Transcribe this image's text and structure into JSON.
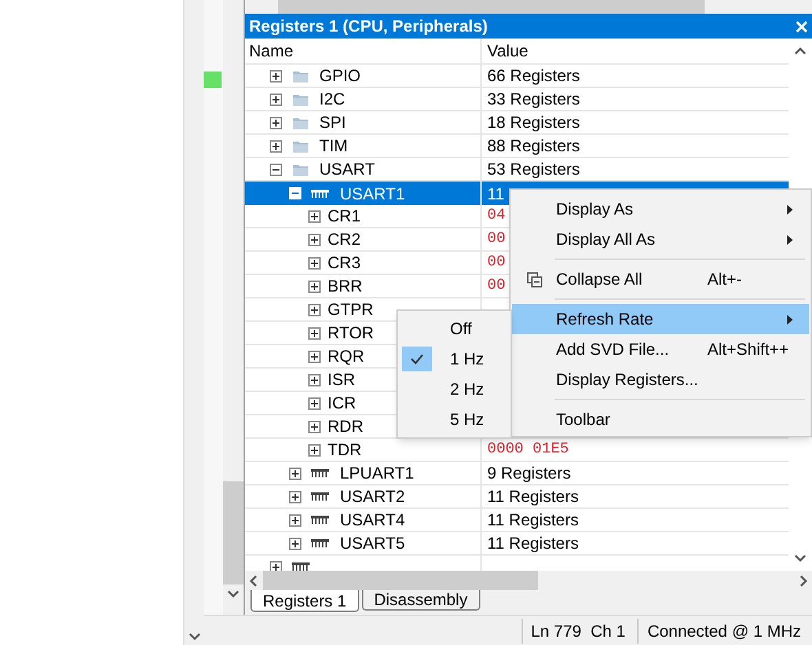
{
  "panel": {
    "title": "Registers 1 (CPU, Peripherals)",
    "columns": [
      "Name",
      "Value"
    ],
    "tree": [
      {
        "name": "GPIO",
        "value": "66 Registers",
        "kind": "group",
        "expanded": false,
        "selected": false
      },
      {
        "name": "I2C",
        "value": "33 Registers",
        "kind": "group",
        "expanded": false,
        "selected": false
      },
      {
        "name": "SPI",
        "value": "18 Registers",
        "kind": "group",
        "expanded": false,
        "selected": false
      },
      {
        "name": "TIM",
        "value": "88 Registers",
        "kind": "group",
        "expanded": false,
        "selected": false
      },
      {
        "name": "USART",
        "value": "53 Registers",
        "kind": "group",
        "expanded": true,
        "selected": false,
        "children": [
          {
            "name": "USART1",
            "value": "11",
            "kind": "peripheral",
            "expanded": true,
            "selected": true,
            "children": [
              {
                "name": "CR1",
                "value": "04",
                "kind": "register",
                "expanded": false,
                "selected": false,
                "changed": true
              },
              {
                "name": "CR2",
                "value": "00",
                "kind": "register",
                "expanded": false,
                "selected": false,
                "changed": true
              },
              {
                "name": "CR3",
                "value": "00",
                "kind": "register",
                "expanded": false,
                "selected": false,
                "changed": true
              },
              {
                "name": "BRR",
                "value": "00",
                "kind": "register",
                "expanded": false,
                "selected": false,
                "changed": true
              },
              {
                "name": "GTPR",
                "kind": "register",
                "expanded": false,
                "selected": false
              },
              {
                "name": "RTOR",
                "kind": "register",
                "expanded": false,
                "selected": false
              },
              {
                "name": "RQR",
                "kind": "register",
                "expanded": false,
                "selected": false
              },
              {
                "name": "ISR",
                "kind": "register",
                "expanded": false,
                "selected": false
              },
              {
                "name": "ICR",
                "kind": "register",
                "expanded": false,
                "selected": false
              },
              {
                "name": "RDR",
                "kind": "register",
                "expanded": false,
                "selected": false
              },
              {
                "name": "TDR",
                "value": "0000 01E5",
                "kind": "register",
                "expanded": false,
                "selected": false,
                "changed": true
              }
            ]
          },
          {
            "name": "LPUART1",
            "value": "9 Registers",
            "kind": "peripheral",
            "expanded": false,
            "selected": false
          },
          {
            "name": "USART2",
            "value": "11 Registers",
            "kind": "peripheral",
            "expanded": false,
            "selected": false
          },
          {
            "name": "USART4",
            "value": "11 Registers",
            "kind": "peripheral",
            "expanded": false,
            "selected": false
          },
          {
            "name": "USART5",
            "value": "11 Registers",
            "kind": "peripheral",
            "expanded": false,
            "selected": false
          }
        ]
      },
      {
        "kind": "peripheral",
        "expanded": false,
        "selected": false
      }
    ]
  },
  "tabs": [
    {
      "label": "Registers 1",
      "selected": true
    },
    {
      "label": "Disassembly",
      "selected": false
    }
  ],
  "status_bar": [
    "Ln 779  Ch 1",
    "Connected @ 1 MHz"
  ],
  "context_menu": [
    {
      "kind": "item",
      "label": "Display As",
      "submenu": true,
      "highlighted": false
    },
    {
      "kind": "item",
      "label": "Display All As",
      "submenu": true,
      "highlighted": false
    },
    {
      "kind": "separator"
    },
    {
      "kind": "icon_item",
      "label": "Collapse All",
      "shortcut": "Alt+-",
      "submenu": false,
      "highlighted": false
    },
    {
      "kind": "separator"
    },
    {
      "kind": "item",
      "label": "Refresh Rate",
      "submenu": true,
      "highlighted": true
    },
    {
      "kind": "item",
      "label": "Add SVD File...",
      "shortcut": "Alt+Shift++",
      "submenu": false,
      "highlighted": false
    },
    {
      "kind": "item",
      "label": "Display Registers...",
      "submenu": false,
      "highlighted": false
    },
    {
      "kind": "separator"
    },
    {
      "kind": "item",
      "label": "Toolbar",
      "submenu": false,
      "highlighted": false
    }
  ],
  "refresh_submenu": [
    {
      "label": "Off",
      "checked": false
    },
    {
      "label": "1 Hz",
      "checked": true
    },
    {
      "label": "2 Hz",
      "checked": false
    },
    {
      "label": "5 Hz",
      "checked": false
    }
  ]
}
